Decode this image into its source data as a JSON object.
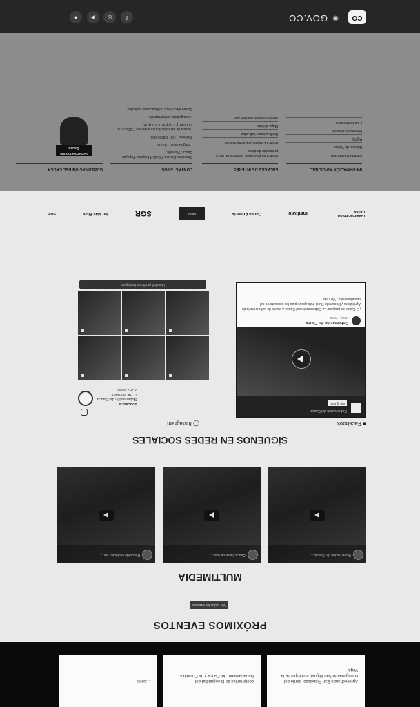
{
  "header": {
    "logo_text": "CO",
    "brand": "GOV.CO",
    "social_icons": [
      "facebook-icon",
      "instagram-icon",
      "youtube-icon",
      "flickr-icon"
    ]
  },
  "news": {
    "cards": [
      {
        "text": "Aprovechando San Francisco, barrio del corregimiento San Miguel, municipio de la Vega"
      },
      {
        "text": "compromiso de la seguridad del Departamento del Cauca y de Colombia"
      },
      {
        "text": "...ceno"
      }
    ]
  },
  "events": {
    "title": "PRÓXIMOS EVENTOS",
    "button": "Ver todos los eventos"
  },
  "multimedia": {
    "title": "MULTIMEDIA",
    "videos": [
      {
        "meta": "Gobernación del Cauca ..."
      },
      {
        "meta": "Cauca, tierra de uva ..."
      },
      {
        "meta": "Recorrido ecológico por ..."
      }
    ]
  },
  "social": {
    "title": "SÍGUENOS EN REDES SOCIALES",
    "facebook": {
      "label": "Facebook",
      "page_name": "Gobernación del Cauca",
      "like_label": "Me gusta",
      "post_author": "Gobernación del Cauca",
      "post_when": "hace 1 hora",
      "post_text": "¡El Cauca se prepara! La Gobernación del Cauca a través de la Secretaría de Agricultura y Desarrollo Rural más apoyo para los productores del departamento... Ver más"
    },
    "instagram": {
      "label": "Instagram",
      "handle": "gobcauca",
      "name": "Gobernación del Cauca",
      "followers": "11,3K followers",
      "posts": "2,252 posts",
      "button": "View full profile on Instagram"
    }
  },
  "partners": [
    "Gobernación del Cauca",
    "Instituto",
    "Cauca Anuncia",
    "Ideas",
    "SGR",
    "No Más Filas",
    "Sello"
  ],
  "footer": {
    "columns": [
      {
        "title": "GOBERNACIÓN DEL CAUCA",
        "lines": []
      },
      {
        "title": "CONTÁCTENOS",
        "lines": [
          "Dirección: Carrera 7 Calle 4 Esquina Popayán - Cauca, Vía sede.",
          "Código Postal: 190003",
          "Teléfono: (+57) 8-8201-900",
          "Horario de atención: Lunes a viernes 7:30 a.m. a 12:00 m. y 2:00 p.m. a 6:00 p.m.",
          "Línea gratuita anticorrupción",
          "Correo electrónico notificaciones judiciales"
        ]
      },
      {
        "title": "ENLACES DE INTERÉS",
        "lines": [
          "Política de privacidad, términos de uso y protección de datos",
          "Política Editorial y de Actualización",
          "Notificaciones judiciales",
          "Mapa del sitio",
          "Versión anterior del sitio web"
        ]
      },
      {
        "title": "INFORMACIÓN ADICIONAL",
        "lines": [
          "Última Actualización",
          "Número de Visitas",
          "PQRS",
          "Informe de atención",
          "Chat Institucional"
        ]
      }
    ],
    "emblem_text": "Gobernación del Cauca"
  }
}
